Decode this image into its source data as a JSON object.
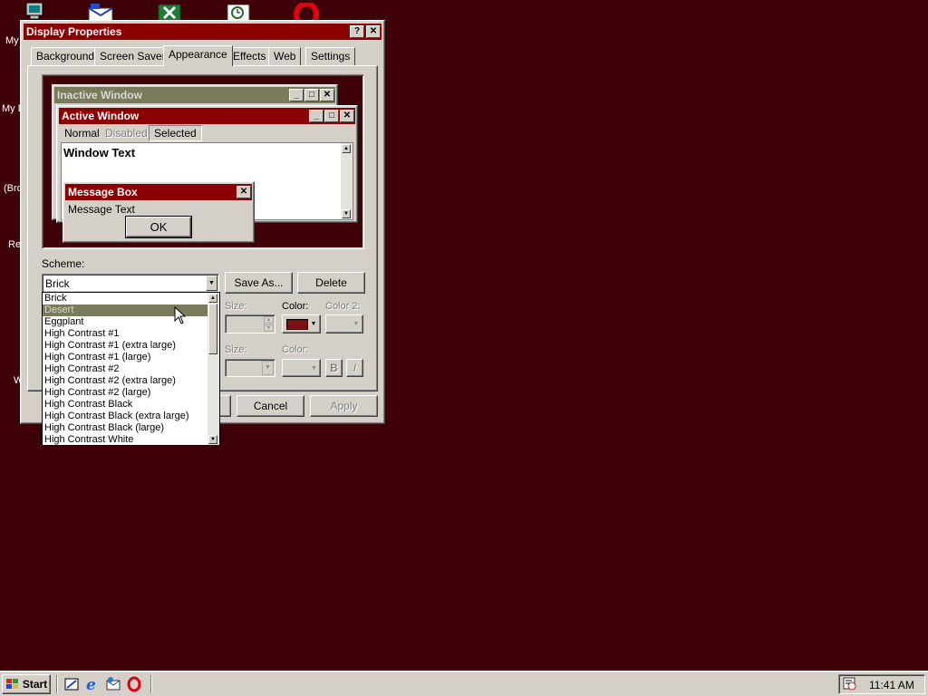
{
  "desktop": {
    "labels": [
      "My",
      "My D",
      "(Bro",
      "Re",
      "W"
    ]
  },
  "dialog": {
    "title": "Display Properties",
    "help_icon": "?",
    "close_icon": "✕",
    "tabs": [
      "Background",
      "Screen Saver",
      "Appearance",
      "Effects",
      "Web",
      "Settings"
    ],
    "active_tab": "Appearance",
    "preview": {
      "inactive_title": "Inactive Window",
      "active_title": "Active Window",
      "menu_normal": "Normal",
      "menu_disabled": "Disabled",
      "menu_selected": "Selected",
      "window_text": "Window Text",
      "msgbox_title": "Message Box",
      "msgbox_text": "Message Text",
      "msgbox_ok": "OK"
    },
    "scheme_label": "Scheme:",
    "scheme_value": "Brick",
    "save_as": "Save As...",
    "delete": "Delete",
    "size_label_1": "Size:",
    "color_label": "Color:",
    "color2_label": "Color 2:",
    "size_label_2": "Size:",
    "color_label_2": "Color:",
    "bold_label": "B",
    "italic_label": "I",
    "cancel": "Cancel",
    "apply": "Apply",
    "scheme_options": [
      "Brick",
      "Desert",
      "Eggplant",
      "High Contrast #1",
      "High Contrast #1 (extra large)",
      "High Contrast #1 (large)",
      "High Contrast #2",
      "High Contrast #2 (extra large)",
      "High Contrast #2 (large)",
      "High Contrast Black",
      "High Contrast Black (extra large)",
      "High Contrast Black (large)",
      "High Contrast White"
    ],
    "highlighted_option": "Desert",
    "selected_color": "#7a1010"
  },
  "taskbar": {
    "start_label": "Start",
    "clock": "11:41 AM"
  },
  "colors": {
    "desktop": "#3f0108",
    "active_title": "#8b0000",
    "inactive_title": "#7b7b5b",
    "face": "#d4d0c8"
  }
}
